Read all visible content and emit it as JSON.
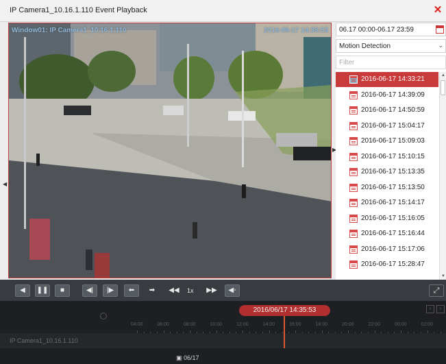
{
  "window": {
    "title": "IP Camera1_10.16.1.110 Event Playback",
    "close_icon": "close-icon"
  },
  "video": {
    "osd_window": "Window01: IP Camera1_10.16.1.110",
    "osd_time": "2016-06-17 14:35:53"
  },
  "search": {
    "date_range": "06.17 00:00-06.17 23:59",
    "event_type": "Motion Detection",
    "filter_placeholder": "Filter"
  },
  "events": [
    {
      "label": "2016-06-17 14:33:21",
      "selected": true
    },
    {
      "label": "2016-06-17 14:39:09",
      "selected": false
    },
    {
      "label": "2016-06-17 14:50:59",
      "selected": false
    },
    {
      "label": "2016-06-17 15:04:17",
      "selected": false
    },
    {
      "label": "2016-06-17 15:09:03",
      "selected": false
    },
    {
      "label": "2016-06-17 15:10:15",
      "selected": false
    },
    {
      "label": "2016-06-17 15:13:35",
      "selected": false
    },
    {
      "label": "2016-06-17 15:13:50",
      "selected": false
    },
    {
      "label": "2016-06-17 15:14:17",
      "selected": false
    },
    {
      "label": "2016-06-17 15:16:05",
      "selected": false
    },
    {
      "label": "2016-06-17 15:16:44",
      "selected": false
    },
    {
      "label": "2016-06-17 15:17:06",
      "selected": false
    },
    {
      "label": "2016-06-17 15:28:47",
      "selected": false
    }
  ],
  "controls": {
    "speed": "1x"
  },
  "timeline": {
    "current_time": "2016/06/17 14:35:53",
    "camera_label": "IP Camera1_10.16.1.110",
    "date_button": "06/17",
    "ticks": [
      "04:00",
      "06:00",
      "08:00",
      "10:00",
      "12:00",
      "14:00",
      "16:00",
      "18:00",
      "20:00",
      "22:00",
      "00:00",
      "02:00"
    ]
  },
  "colors": {
    "accent": "#c93a3a",
    "control_bar": "#383c40",
    "timeline_bg": "#1d1f22",
    "cursor": "#e0582d"
  }
}
